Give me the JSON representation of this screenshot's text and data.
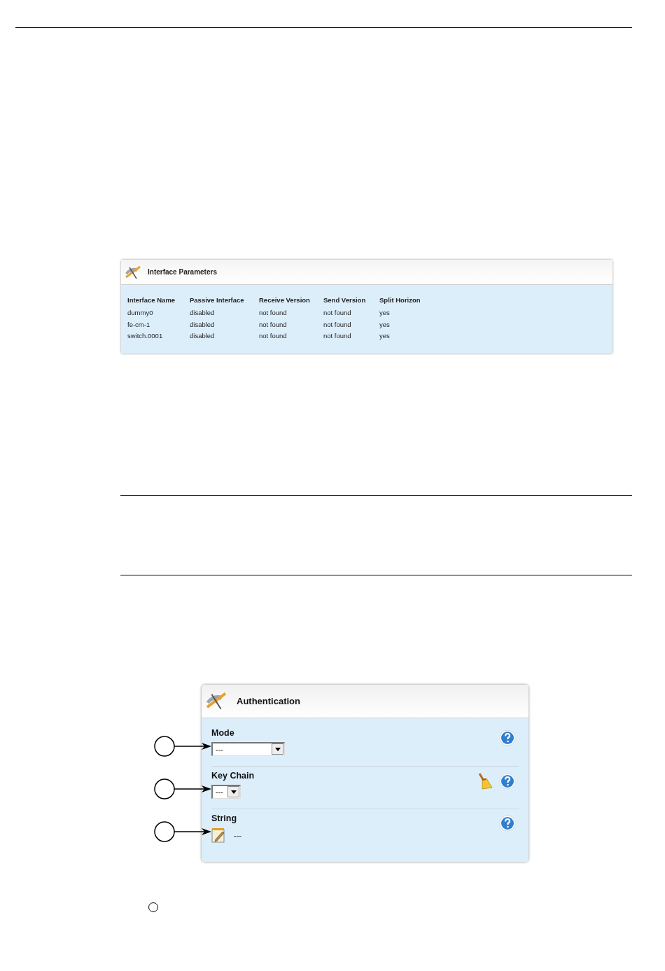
{
  "interface_parameters": {
    "title": "Interface Parameters",
    "columns": [
      "Interface Name",
      "Passive Interface",
      "Receive Version",
      "Send Version",
      "Split Horizon"
    ],
    "rows": [
      [
        "dummy0",
        "disabled",
        "not found",
        "not found",
        "yes"
      ],
      [
        "fe-cm-1",
        "disabled",
        "not found",
        "not found",
        "yes"
      ],
      [
        "switch.0001",
        "disabled",
        "not found",
        "not found",
        "yes"
      ]
    ]
  },
  "authentication": {
    "title": "Authentication",
    "fields": [
      {
        "label": "Mode",
        "kind": "select",
        "value": "---",
        "clearable": false,
        "wide": true
      },
      {
        "label": "Key Chain",
        "kind": "select",
        "value": "---",
        "clearable": true,
        "wide": false
      },
      {
        "label": "String",
        "kind": "text",
        "value": "---",
        "clearable": false,
        "wide": false
      }
    ]
  }
}
